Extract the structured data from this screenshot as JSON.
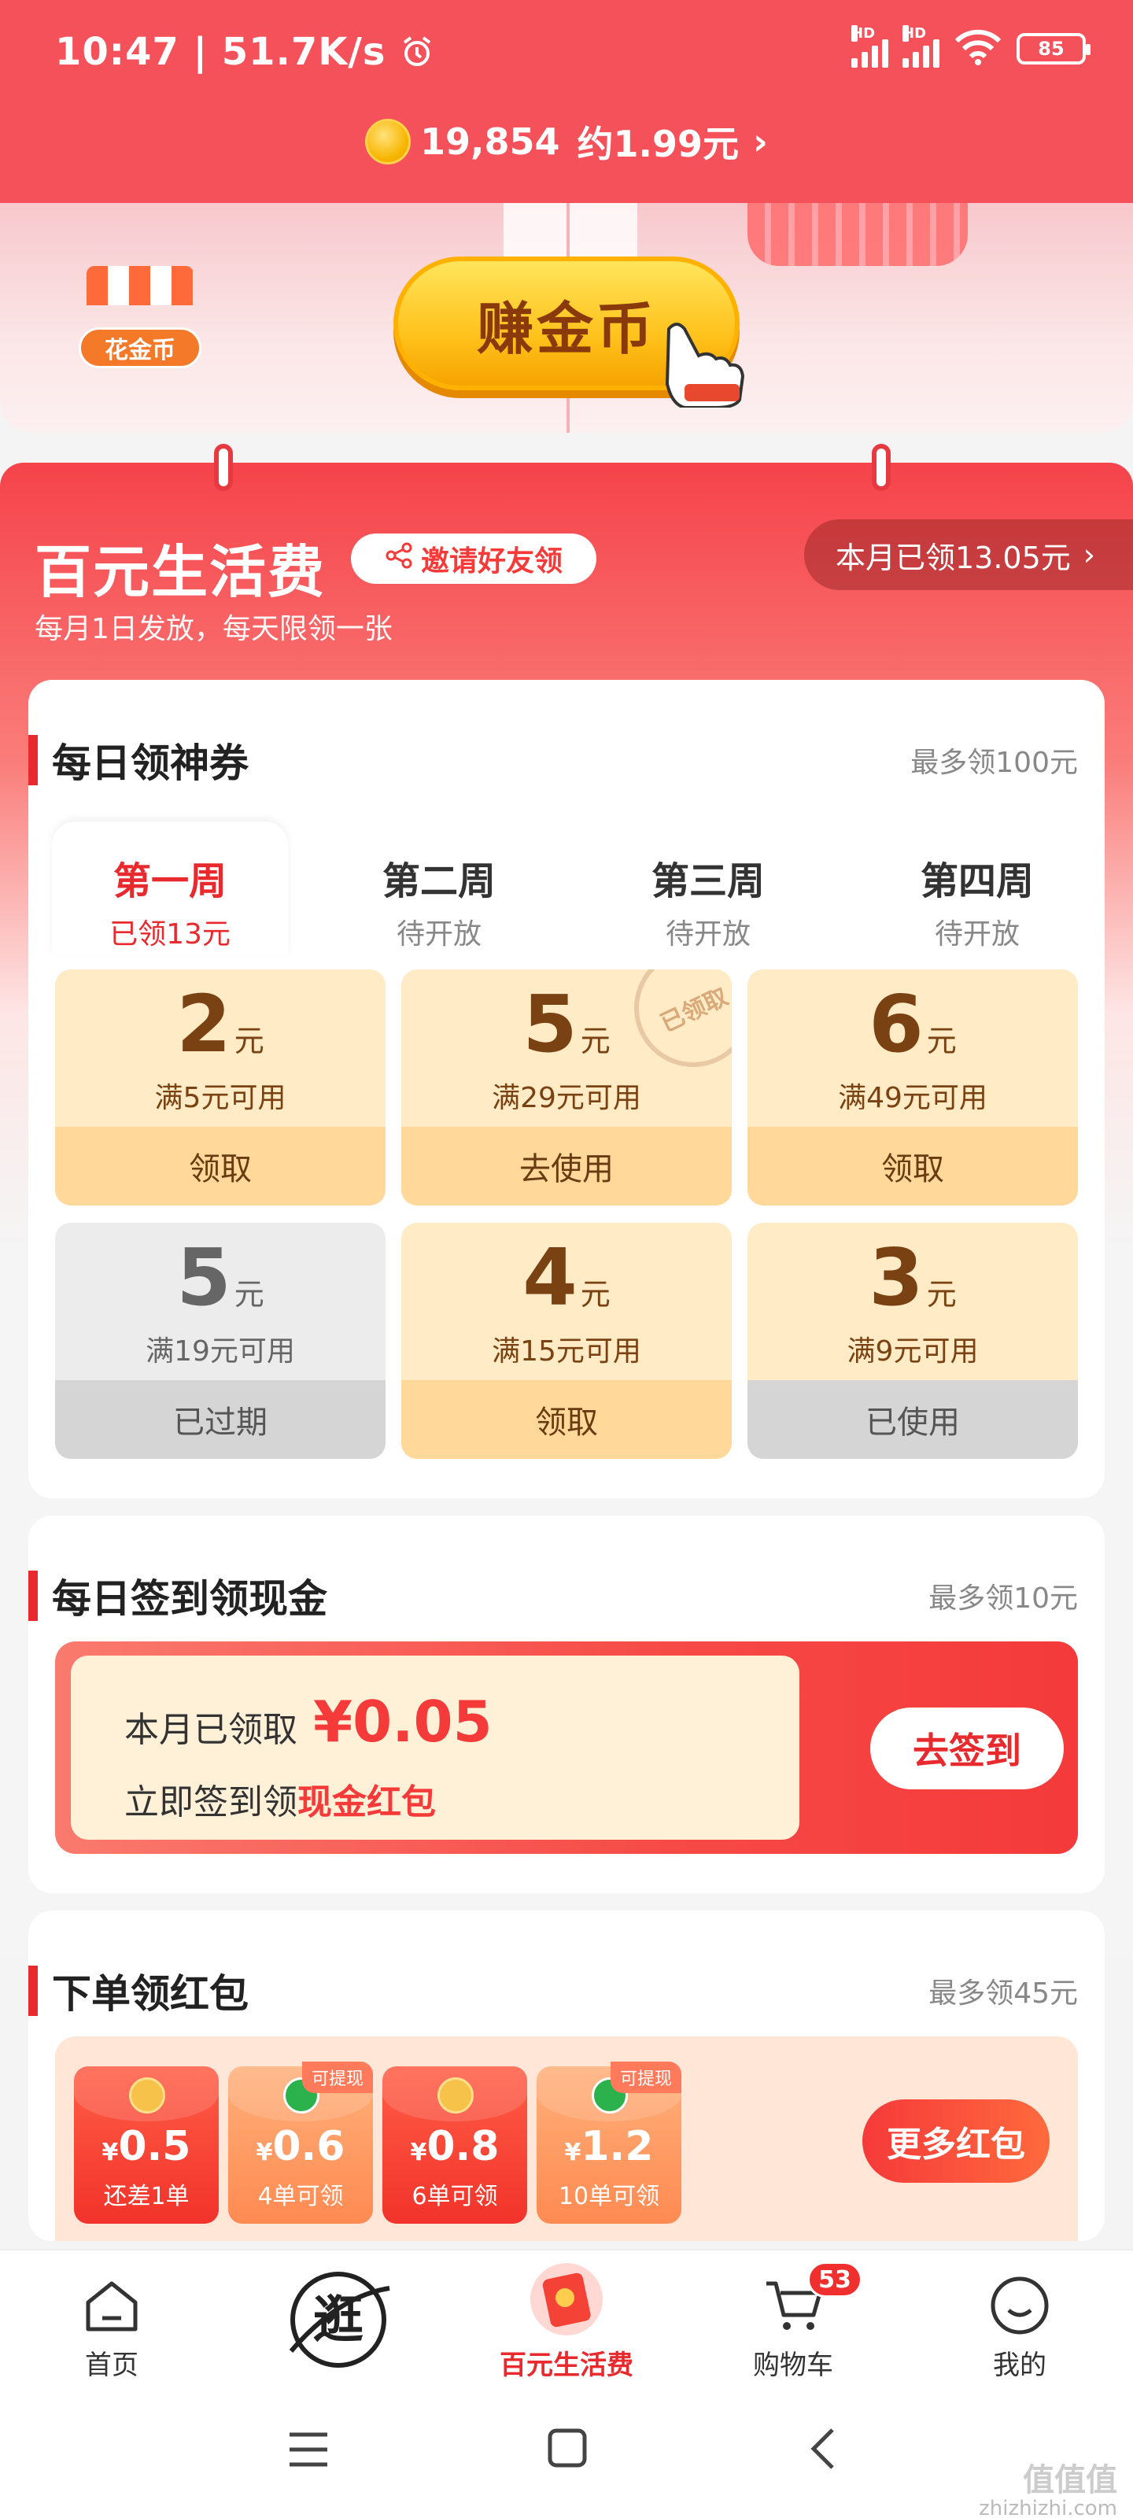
{
  "status_bar": {
    "time": "10:47",
    "speed": "51.7K/s",
    "battery": "85",
    "net1": "HD",
    "net2": "HD"
  },
  "coins": {
    "count": "19,854",
    "equiv": "约1.99元",
    "arrow": "›"
  },
  "banner": {
    "store_label": "花金币",
    "earn_label": "赚金币"
  },
  "life": {
    "title": "百元生活费",
    "invite_label": "邀请好友领",
    "month_claimed": "本月已领13.05元",
    "month_arrow": "›",
    "subtitle": "每月1日发放，每天限领一张"
  },
  "coupons_section": {
    "title": "每日领神券",
    "max_label": "最多领100元",
    "weeks": [
      {
        "name": "第一周",
        "status": "已领13元"
      },
      {
        "name": "第二周",
        "status": "待开放"
      },
      {
        "name": "第三周",
        "status": "待开放"
      },
      {
        "name": "第四周",
        "status": "待开放"
      }
    ],
    "coupons": [
      {
        "amount": "2",
        "unit": "元",
        "condition": "满5元可用",
        "action": "领取"
      },
      {
        "amount": "5",
        "unit": "元",
        "condition": "满29元可用",
        "action": "去使用",
        "stamp": "已领取"
      },
      {
        "amount": "6",
        "unit": "元",
        "condition": "满49元可用",
        "action": "领取"
      },
      {
        "amount": "5",
        "unit": "元",
        "condition": "满19元可用",
        "action": "已过期"
      },
      {
        "amount": "4",
        "unit": "元",
        "condition": "满15元可用",
        "action": "领取"
      },
      {
        "amount": "3",
        "unit": "元",
        "condition": "满9元可用",
        "action": "已使用"
      }
    ]
  },
  "signin_section": {
    "title": "每日签到领现金",
    "max_label": "最多领10元",
    "claimed_label": "本月已领取",
    "claimed_amount": "¥0.05",
    "cta_prefix": "立即签到领",
    "cta_highlight": "现金红包",
    "button": "去签到"
  },
  "order_section": {
    "title": "下单领红包",
    "max_label": "最多领45元",
    "packets": [
      {
        "value": "0.5",
        "currency": "¥",
        "desc": "还差1单"
      },
      {
        "value": "0.6",
        "currency": "¥",
        "desc": "4单可领",
        "tag": "可提现"
      },
      {
        "value": "0.8",
        "currency": "¥",
        "desc": "6单可领"
      },
      {
        "value": "1.2",
        "currency": "¥",
        "desc": "10单可领",
        "tag": "可提现"
      }
    ],
    "more_button": "更多红包"
  },
  "bottom_nav": {
    "items": [
      {
        "label": "首页"
      },
      {
        "label": "逛"
      },
      {
        "label": "百元生活费"
      },
      {
        "label": "购物车",
        "badge": "53"
      },
      {
        "label": "我的"
      }
    ]
  },
  "watermark": {
    "line1": "值值值",
    "line2": "zhizhizhi.com"
  }
}
